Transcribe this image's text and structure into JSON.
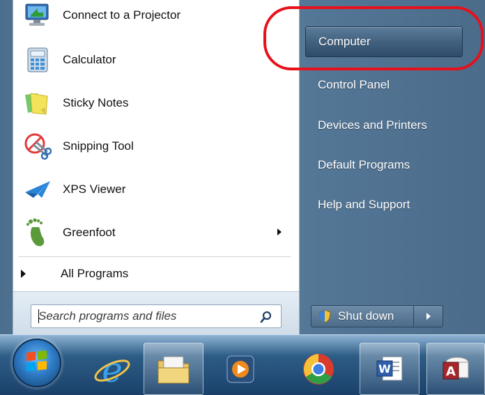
{
  "programs": [
    {
      "label": "Connect to a Projector",
      "icon": "projector-icon"
    },
    {
      "label": "Calculator",
      "icon": "calculator-icon"
    },
    {
      "label": "Sticky Notes",
      "icon": "sticky-notes-icon"
    },
    {
      "label": "Snipping Tool",
      "icon": "snipping-tool-icon"
    },
    {
      "label": "XPS Viewer",
      "icon": "xps-viewer-icon"
    },
    {
      "label": "Greenfoot",
      "icon": "greenfoot-icon",
      "has_submenu": true
    }
  ],
  "all_programs_label": "All Programs",
  "search": {
    "placeholder": "Search programs and files",
    "value": ""
  },
  "right_pane": [
    {
      "label": "Computer",
      "selected": true
    },
    {
      "label": "Control Panel"
    },
    {
      "label": "Devices and Printers"
    },
    {
      "label": "Default Programs"
    },
    {
      "label": "Help and Support"
    }
  ],
  "shutdown_label": "Shut down",
  "annotation_color": "#e8101a",
  "taskbar_items": [
    "start-orb-icon",
    "internet-explorer-icon",
    "file-explorer-icon",
    "media-player-icon",
    "chrome-icon",
    "word-icon",
    "access-icon"
  ]
}
